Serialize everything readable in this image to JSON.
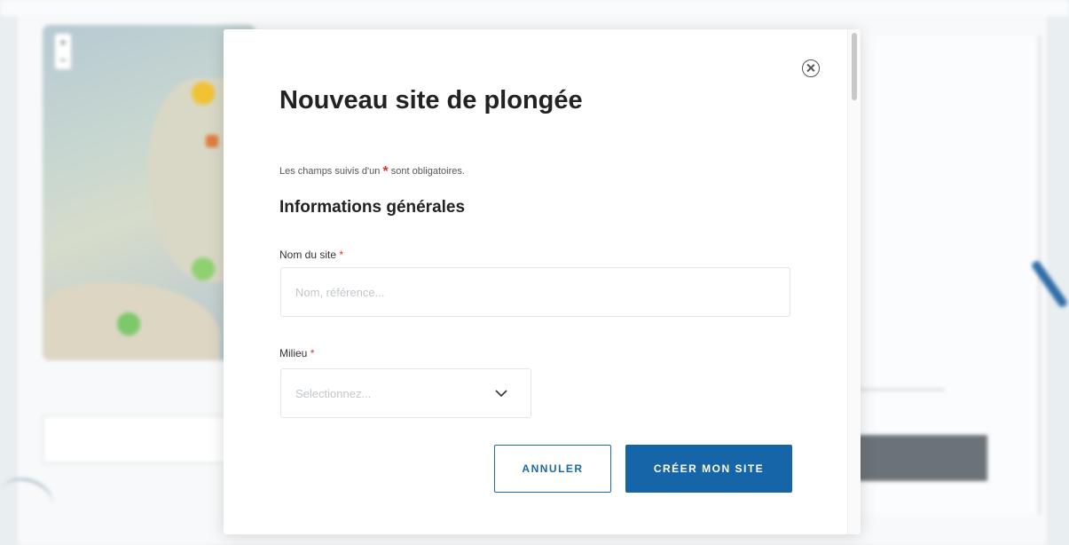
{
  "modal": {
    "title": "Nouveau site de plongée",
    "required_note_before": "Les champs suivis d'un",
    "required_note_star": "*",
    "required_note_after": "sont obligatoires.",
    "section_title": "Informations générales",
    "fields": {
      "name": {
        "label": "Nom du site",
        "required": "*",
        "placeholder": "Nom, référence..."
      },
      "milieu": {
        "label": "Milieu",
        "required": "*",
        "placeholder": "Selectionnez..."
      }
    },
    "buttons": {
      "cancel": "ANNULER",
      "create": "CRÉER MON SITE"
    }
  },
  "colors": {
    "primary": "#1565a8",
    "required": "#e0312b"
  },
  "icons": {
    "close": "close-circle-icon",
    "select_arrow": "chevron-down-icon"
  }
}
